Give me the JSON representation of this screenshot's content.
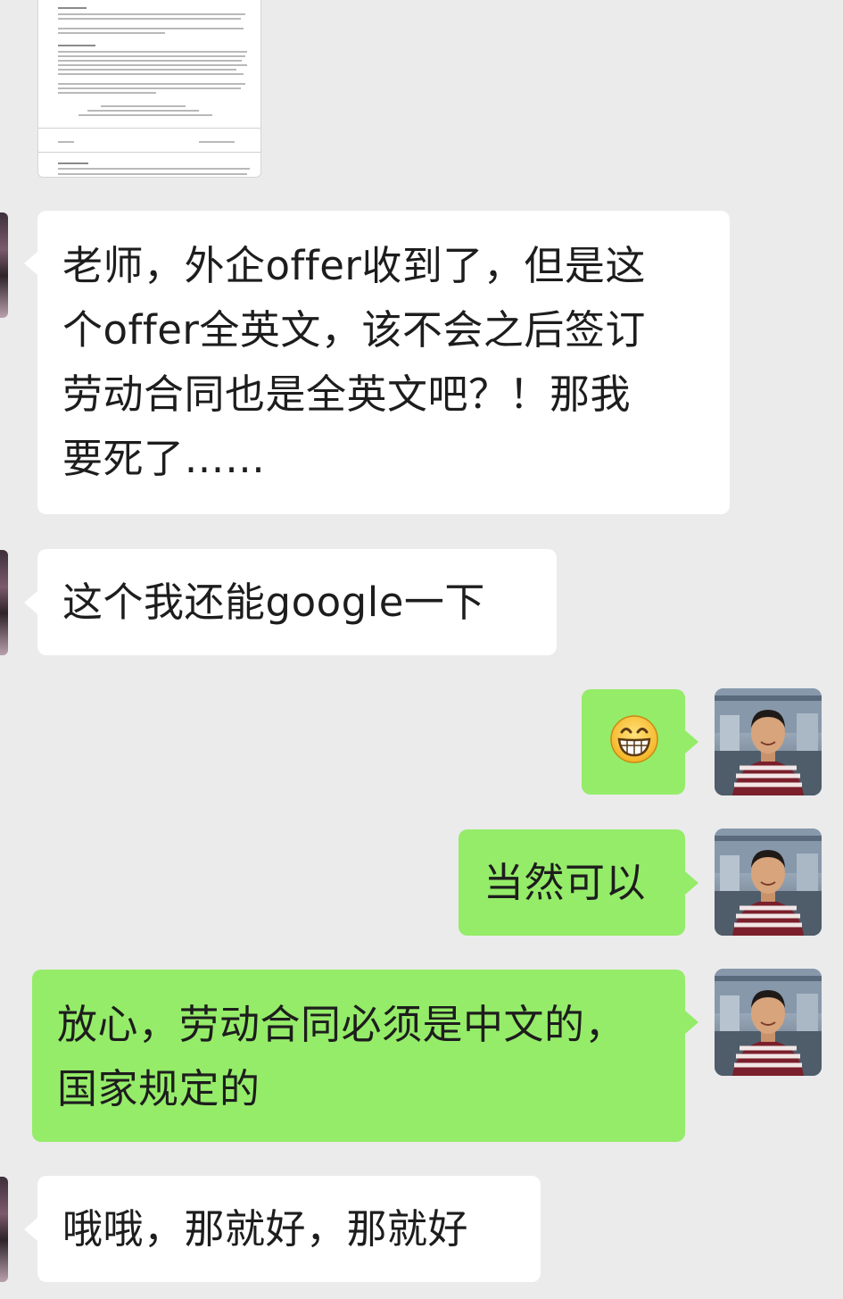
{
  "messages": [
    {
      "from": "contact",
      "type": "image",
      "icon": "document-image"
    },
    {
      "from": "contact",
      "type": "text",
      "lines": [
        "老师，外企offer收到了，但是这",
        "个offer全英文，该不会之后签订",
        "劳动合同也是全英文吧？！那我",
        "要死了……"
      ]
    },
    {
      "from": "contact",
      "type": "text",
      "text": "这个我还能google一下"
    },
    {
      "from": "self",
      "type": "emoji",
      "icon": "grinning-face-emoji"
    },
    {
      "from": "self",
      "type": "text",
      "text": "当然可以"
    },
    {
      "from": "self",
      "type": "text",
      "lines": [
        "放心，劳动合同必须是中文的，",
        "国家规定的"
      ]
    },
    {
      "from": "contact",
      "type": "text",
      "text": "哦哦，那就好，那就好"
    }
  ],
  "colors": {
    "background": "#ebebeb",
    "incoming_bubble": "#ffffff",
    "outgoing_bubble": "#95ec69",
    "text": "#1d1d1d"
  }
}
